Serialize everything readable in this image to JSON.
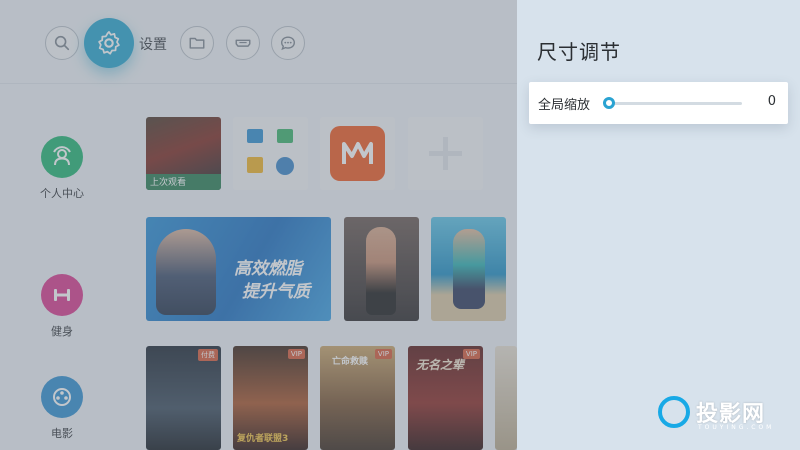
{
  "top_bar": {
    "icons": [
      "search-icon",
      "gear-icon",
      "folder-icon",
      "hdmi-icon",
      "chat-icon"
    ],
    "settings_label": "设置"
  },
  "sidebar": {
    "items": [
      {
        "label": "个人中心",
        "icon": "user-center-icon",
        "color": "#22b573"
      },
      {
        "label": "健身",
        "icon": "dumbbell-icon",
        "color": "#d9398e"
      },
      {
        "label": "电影",
        "icon": "film-reel-icon",
        "color": "#2f8fd0"
      }
    ]
  },
  "tiles": {
    "recent_label": "上次观看",
    "fitness_banner_line1": "高效燃脂",
    "fitness_banner_line2": "提升气质",
    "movie_badges": [
      "付费",
      "VIP",
      "VIP",
      "VIP",
      ""
    ],
    "movie_titles": [
      "",
      "复仇者联盟3",
      "亡命救赎",
      "无名之辈",
      ""
    ]
  },
  "panel": {
    "title": "尺寸调节",
    "scale_label": "全局缩放",
    "scale_value": "0",
    "scale_fraction": 0
  },
  "watermark": {
    "text": "投影网",
    "sub": "TOUYING.COM"
  },
  "colors": {
    "accent": "#26a6cf",
    "panel_bg": "#d7e2ec"
  }
}
